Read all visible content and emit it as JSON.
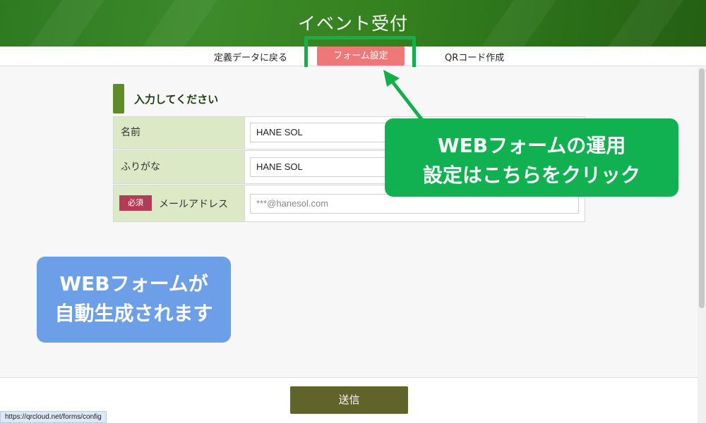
{
  "header": {
    "title": "イベント受付"
  },
  "nav": {
    "items": [
      {
        "label": "定義データに戻る"
      },
      {
        "label": "フォーム設定",
        "active": true
      },
      {
        "label": "QRコード作成"
      }
    ]
  },
  "section": {
    "title": "入力してください"
  },
  "form": {
    "rows": [
      {
        "label": "名前",
        "value": "HANE SOL"
      },
      {
        "label": "ふりがな",
        "value": "HANE SOL"
      },
      {
        "label": "メールアドレス",
        "placeholder": "***@hanesol.com",
        "required_label": "必須"
      }
    ]
  },
  "callouts": {
    "settings": {
      "line1": "WEBフォームの運用",
      "line2": "設定はこちらをクリック"
    },
    "auto": {
      "line1": "WEBフォームが",
      "line2": "自動生成されます"
    }
  },
  "submit": {
    "label": "送信"
  },
  "status_bar": {
    "url": "https://qrcloud.net/forms/config"
  },
  "colors": {
    "header_green": "#2f7a21",
    "active_tab": "#ee7777",
    "highlight": "#11b04a",
    "label_bg": "#dce9c6",
    "required_badge": "#b43b55",
    "submit_button": "#60632a",
    "callout_green": "#11b050",
    "callout_blue": "#6d9fe8"
  }
}
